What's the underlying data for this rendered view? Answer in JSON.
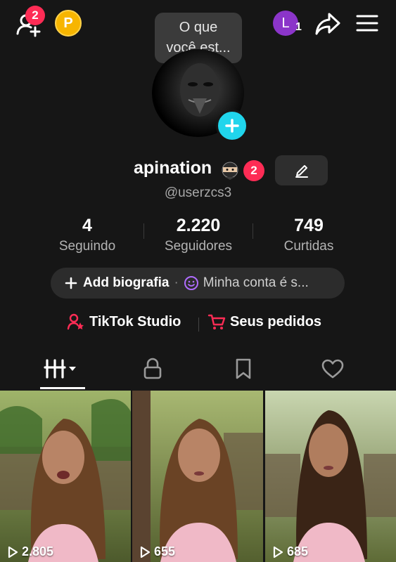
{
  "topbar": {
    "friend_badge": "2",
    "coin_letter": "P",
    "tooltip_line1": "O que",
    "tooltip_line2": "você est...",
    "account_initial": "L",
    "account_count": "1"
  },
  "profile": {
    "username": "apination",
    "name_badge": "2",
    "handle": "@userzcs3"
  },
  "stats": [
    {
      "value": "4",
      "label": "Seguindo"
    },
    {
      "value": "2.220",
      "label": "Seguidores"
    },
    {
      "value": "749",
      "label": "Curtidas"
    }
  ],
  "bio": {
    "add_label": "Add biografia",
    "separator": "·",
    "account_text": "Minha conta é s..."
  },
  "links": {
    "studio": "TikTok Studio",
    "orders": "Seus pedidos"
  },
  "videos": [
    {
      "views": "2.805"
    },
    {
      "views": "655"
    },
    {
      "views": "685"
    }
  ],
  "colors": {
    "background": "#161616",
    "accent_red": "#fe2c55",
    "accent_cyan": "#20d5ec",
    "coin": "#f7b500",
    "avatar_purple": "#8b35c9"
  }
}
